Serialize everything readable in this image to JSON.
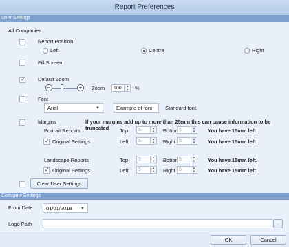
{
  "window": {
    "title": "Report Preferences"
  },
  "user_settings": {
    "section_label": "User Settings",
    "all_companies_label": "All Companies",
    "report_position": {
      "label": "Report Position",
      "options": [
        "Left",
        "Centre",
        "Right"
      ],
      "selected": "Centre"
    },
    "fill_screen": {
      "label": "Fill Screen",
      "checked": false
    },
    "default_zoom": {
      "label": "Default Zoom",
      "checked": true,
      "zoom_label": "Zoom",
      "zoom_value": "100",
      "zoom_unit": "%"
    },
    "font": {
      "label": "Font",
      "checked": false,
      "family": "Arial",
      "example_text": "Example of font",
      "standard_note": "Standard font."
    },
    "margins": {
      "label": "Margins",
      "checked": false,
      "warning": "If your margins add up to more than 25mm this can cause information to be truncated",
      "portrait": {
        "label": "Portrait Reports",
        "original_label": "Original Settings",
        "top_label": "Top",
        "top": "5",
        "bottom_label": "Bottom",
        "bottom": "5",
        "left_label": "Left",
        "left": "5",
        "right_label": "Right",
        "right": "5",
        "status1": "You have 15mm left.",
        "status2": "You have 15mm left."
      },
      "landscape": {
        "label": "Landscape Reports",
        "original_label": "Original Settings",
        "top_label": "Top",
        "top": "5",
        "bottom_label": "Bottom",
        "bottom": "5",
        "left_label": "Left",
        "left": "5",
        "right_label": "Right",
        "right": "5",
        "status1": "You have 15mm left.",
        "status2": "You have 15mm left."
      }
    },
    "clear_button": "Clear User Settings"
  },
  "company_settings": {
    "section_label": "Company Settings",
    "from_date_label": "From Date",
    "from_date": "01/01/2018",
    "logo_path_label": "Logo Path",
    "logo_path": "",
    "browse_label": "..."
  },
  "footer": {
    "ok": "OK",
    "cancel": "Cancel"
  },
  "icons": {
    "zoom_out": "minus-circle-icon",
    "zoom_in": "plus-circle-icon",
    "dropdown": "chevron-down-icon",
    "spin": "spin-arrows-icon"
  }
}
